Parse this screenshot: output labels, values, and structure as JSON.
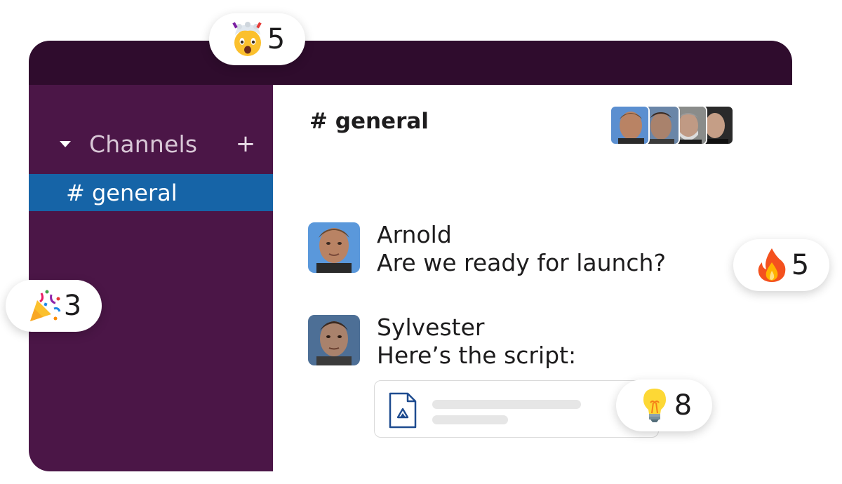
{
  "sidebar": {
    "section_label": "Channels",
    "add_label": "+",
    "channels": [
      {
        "label": "# general",
        "selected": true
      }
    ]
  },
  "channel": {
    "title": "# general",
    "member_avatars": [
      "arnold",
      "sylvester",
      "mel",
      "bruce"
    ]
  },
  "messages": [
    {
      "author": "Arnold",
      "text": "Are we ready for launch?",
      "avatar": "arnold"
    },
    {
      "author": "Sylvester",
      "text": "Here’s the script:",
      "avatar": "sylvester",
      "attachment": {
        "icon": "google-drive-file-icon"
      }
    }
  ],
  "reactions": [
    {
      "emoji": "exploding-head",
      "count": "5"
    },
    {
      "emoji": "fire",
      "count": "5"
    },
    {
      "emoji": "party-popper",
      "count": "3"
    },
    {
      "emoji": "light-bulb",
      "count": "8"
    }
  ],
  "colors": {
    "titlebar": "#2f0c2d",
    "sidebar": "#4b1647",
    "selected_channel": "#1664a7"
  }
}
